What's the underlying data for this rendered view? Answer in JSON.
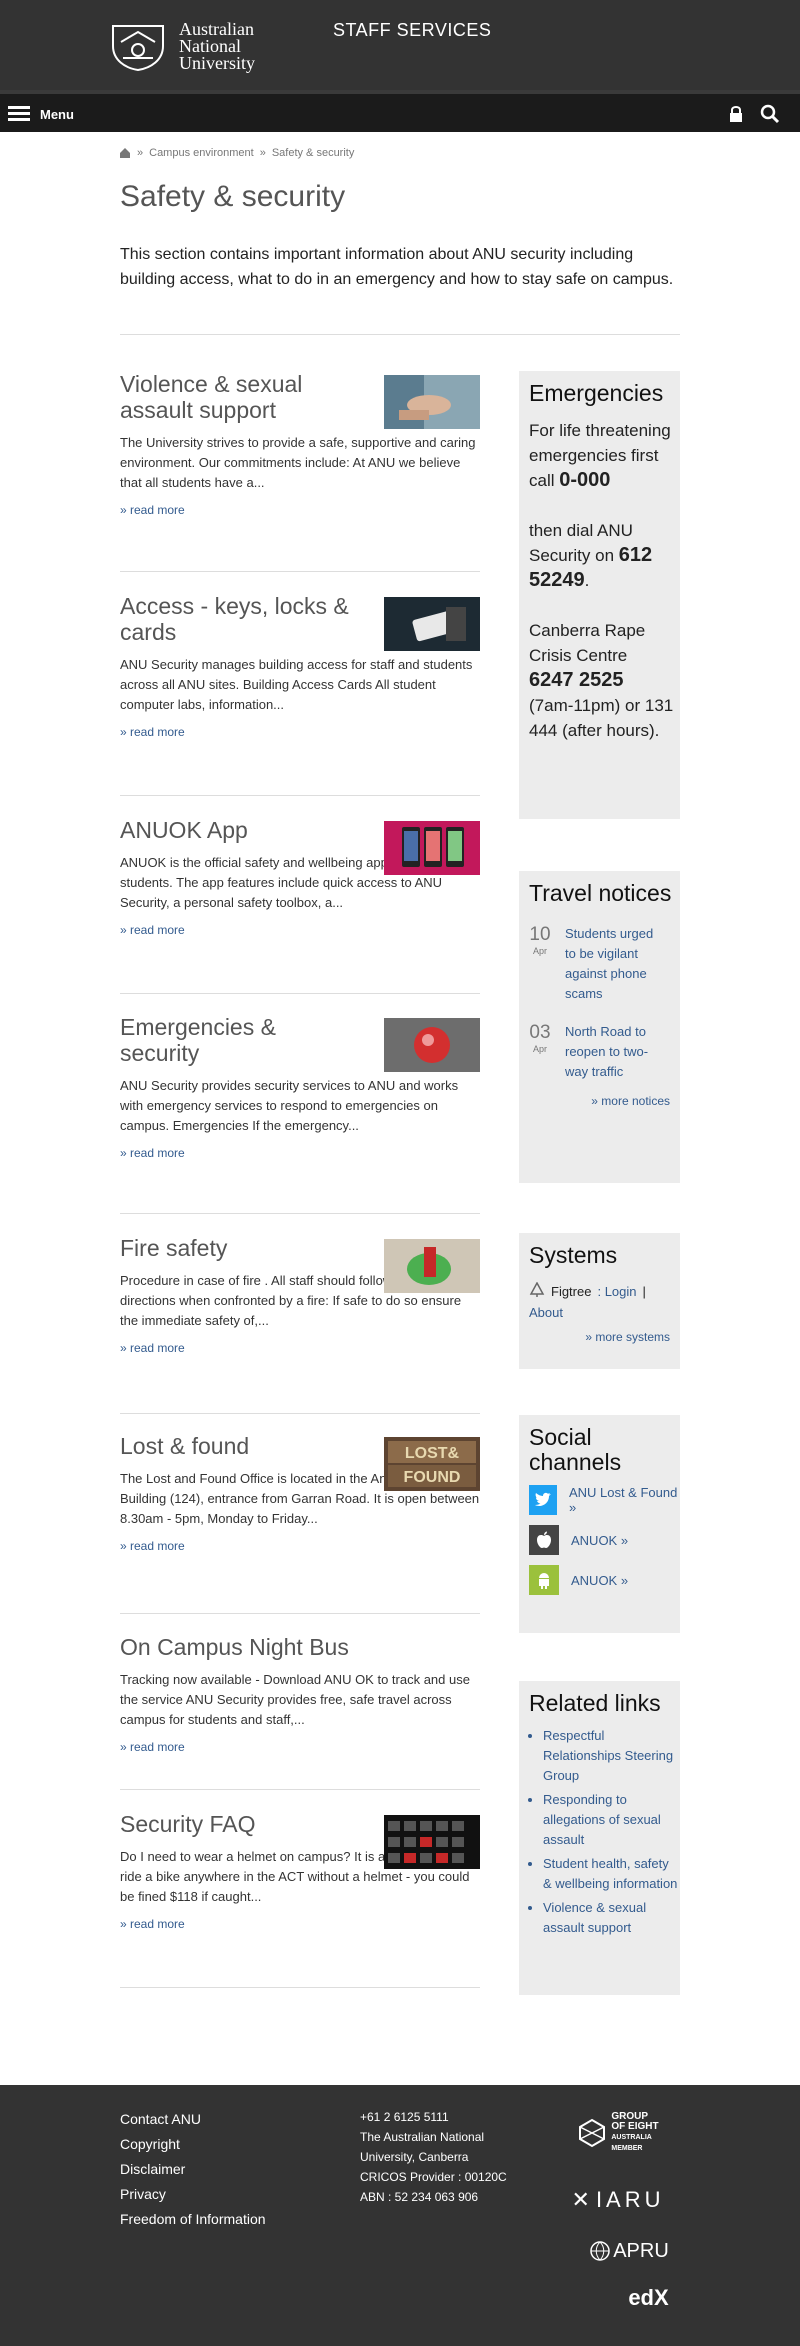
{
  "header": {
    "logo_text": [
      "Australian",
      "National",
      "University"
    ],
    "site_title": "STAFF SERVICES",
    "menu_label": "Menu"
  },
  "breadcrumb": [
    "Campus environment",
    "Safety & security"
  ],
  "page": {
    "title": "Safety & security",
    "intro": "This section contains important information about ANU security including building access, what to do in an emergency and how to stay safe on campus."
  },
  "articles": [
    {
      "title": "Violence & sexual assault support",
      "text": "The University strives to provide a safe, supportive and caring environment. Our commitments include: At ANU we believe that all students have a...",
      "more": "» read more",
      "thumb_icon": "hand-photo"
    },
    {
      "title": "Access - keys, locks & cards",
      "text": "ANU Security manages building access for staff and students across all ANU sites. Building Access Cards All student computer labs, information...",
      "more": "» read more",
      "thumb_icon": "card-reader-photo"
    },
    {
      "title": "ANUOK App",
      "text": "ANUOK is the official safety and wellbeing app for ANU students. The app features include quick access to ANU Security, a personal safety toolbox, a...",
      "more": "» read more",
      "thumb_icon": "app-screens-photo"
    },
    {
      "title": "Emergencies & security",
      "text": "ANU Security provides security services to ANU and works with emergency services to respond to emergencies on campus. Emergencies If the emergency...",
      "more": "» read more",
      "thumb_icon": "alarm-button-photo"
    },
    {
      "title": "Fire safety",
      "text": "Procedure in case of fire . All staff should follow these directions when confronted by a fire: If safe to do so ensure the immediate safety of,...",
      "more": "» read more",
      "thumb_icon": "fire-extinguisher-photo"
    },
    {
      "title": "Lost & found",
      "text": "The Lost and Found Office is located in the Anthony Low Building (124), entrance from Garran Road. It is open between 8.30am - 5pm, Monday to Friday...",
      "more": "» read more",
      "thumb_icon": "lost-found-photo"
    },
    {
      "title": "On Campus Night Bus",
      "text": "Tracking now available - Download ANU OK to track and use the service ANU Security provides free, safe travel across campus for students and staff,...",
      "more": "» read more",
      "thumb_icon": ""
    },
    {
      "title": "Security FAQ",
      "text": "Do I need to wear a helmet on campus? It is against the law to ride a bike anywhere in the ACT without a helmet - you could be fined $118 if caught...",
      "more": "» read more",
      "thumb_icon": "keyboard-photo"
    }
  ],
  "emergencies": {
    "title": "Emergencies",
    "line1": "For life threatening emergencies first call",
    "number1": "0-000",
    "line2": "then dial ANU Security on",
    "number2a": "612",
    "number2b": "52249",
    "line3": "Canberra Rape Crisis Centre",
    "number3": "6247 2525",
    "line4": "(7am-11pm) or 131 444 (after hours)."
  },
  "travel": {
    "title": "Travel notices",
    "items": [
      {
        "day": "10",
        "month": "Apr",
        "text": "Students urged to be vigilant against phone scams"
      },
      {
        "day": "03",
        "month": "Apr",
        "text": "North Road to reopen to two-way traffic"
      }
    ],
    "more": "» more notices"
  },
  "systems": {
    "title": "Systems",
    "figtree": "Figtree",
    "login": ": Login",
    "sep": "|",
    "about": "About",
    "more": "» more systems"
  },
  "social": {
    "title": "Social channels",
    "items": [
      {
        "label": "ANU Lost & Found »",
        "icon": "twitter-icon",
        "color": "#1da1f2"
      },
      {
        "label": "ANUOK »",
        "icon": "apple-icon",
        "color": "#444444"
      },
      {
        "label": "ANUOK »",
        "icon": "android-icon",
        "color": "#9bc13c"
      }
    ]
  },
  "related": {
    "title": "Related links",
    "items": [
      "Respectful Relationships Steering Group",
      "Responding to allegations of sexual assault",
      "Student health, safety & wellbeing information",
      "Violence & sexual assault support"
    ]
  },
  "footer": {
    "links": [
      "Contact ANU",
      "Copyright",
      "Disclaimer",
      "Privacy",
      "Freedom of Information"
    ],
    "info": [
      "+61 2 6125 5111",
      "The Australian National",
      "University, Canberra",
      "CRICOS Provider : 00120C",
      "ABN : 52 234 063 906"
    ],
    "partners": {
      "go8_line1": "GROUP",
      "go8_line2": "OF EIGHT",
      "go8_line3": "AUSTRALIA",
      "go8_member": "MEMBER",
      "iaru": "IARU",
      "apru": "APRU",
      "edx": "edX"
    }
  },
  "colors": {
    "link": "#335b8e",
    "header_bg": "#333333",
    "side_bg": "#ececec"
  }
}
